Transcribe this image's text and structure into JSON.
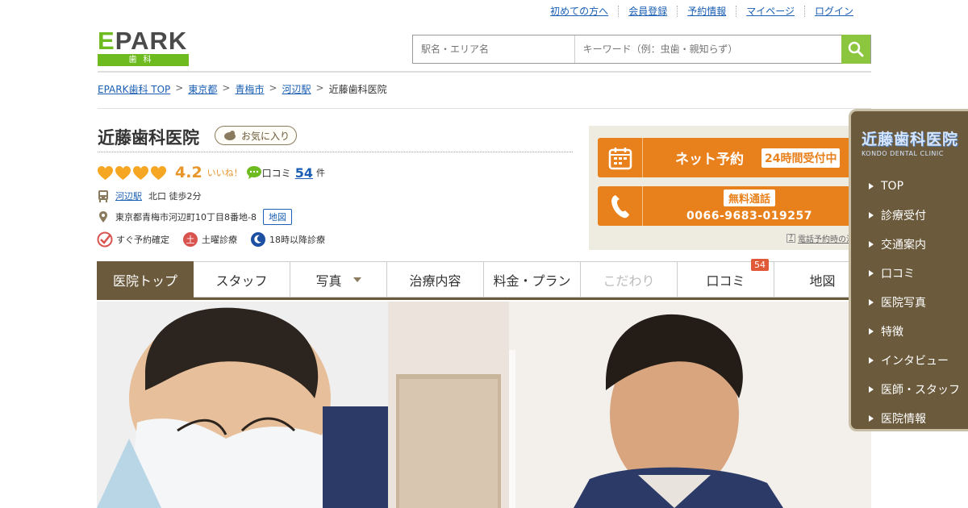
{
  "header": {
    "links": [
      "初めての方へ",
      "会員登録",
      "予約情報",
      "マイページ",
      "ログイン"
    ],
    "logo_text": "EPARK",
    "logo_sub": "歯科",
    "search_area_placeholder": "駅名・エリア名",
    "search_keyword_placeholder": "キーワード（例：虫歯・親知らず）"
  },
  "breadcrumb": [
    "EPARK歯科 TOP",
    "東京都",
    "青梅市",
    "河辺駅",
    "近藤歯科医院"
  ],
  "clinic": {
    "name": "近藤歯科医院",
    "favorite_label": "お気に入り",
    "rating": "4.2",
    "rating_fraction": 0.84,
    "iine": "いいね！",
    "kuchikomi_label": "口コミ",
    "kuchikomi_count": "54",
    "ken": "件",
    "station": "河辺駅",
    "access": "北口 徒歩2分",
    "address": "東京都青梅市河辺町10丁目8番地-8",
    "map_label": "地図",
    "badges": [
      "すぐ予約確定",
      "土曜診療",
      "18時以降診療"
    ]
  },
  "reserve": {
    "net_label": "ネット予約",
    "h24_label": "24時間受付中",
    "free_call": "無料通話",
    "tel": "0066-9683-019257",
    "tel_help": "電話予約時の注"
  },
  "tabs": [
    {
      "label": "医院トップ"
    },
    {
      "label": "スタッフ"
    },
    {
      "label": "写真"
    },
    {
      "label": "治療内容"
    },
    {
      "label": "料金・プラン"
    },
    {
      "label": "こだわり"
    },
    {
      "label": "口コミ",
      "badge": "54"
    },
    {
      "label": "地図"
    }
  ],
  "side_menu": {
    "logo_jp": "近藤歯科医院",
    "logo_en": "KONDO DENTAL CLINIC",
    "items": [
      "TOP",
      "診療受付",
      "交通案内",
      "口コミ",
      "医院写真",
      "特徴",
      "インタビュー",
      "医師・スタッフ",
      "医院情報"
    ]
  },
  "colors": {
    "brand_green": "#6dbb1e",
    "orange": "#e8801c",
    "brown": "#6b5a3b",
    "rating_orange": "#e8952b"
  }
}
